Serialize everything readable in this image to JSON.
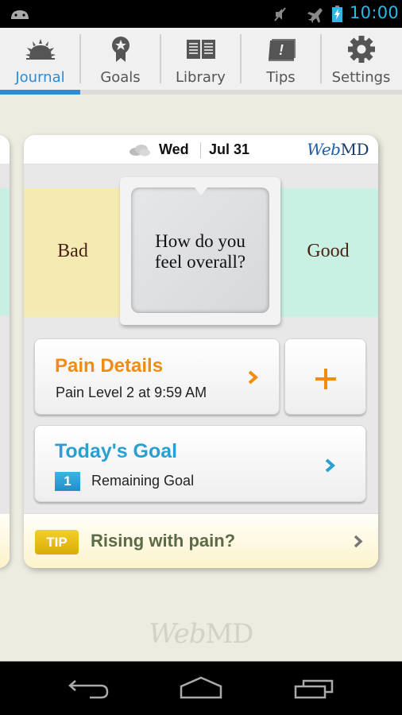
{
  "status_bar": {
    "time": "10:00",
    "icons": [
      "android-icon",
      "mute-icon",
      "airplane-mode-icon",
      "battery-charging-icon"
    ],
    "accent_color": "#33b5e5"
  },
  "tabs": [
    {
      "label": "Journal",
      "icon": "sunrise-icon",
      "active": true
    },
    {
      "label": "Goals",
      "icon": "award-ribbon-icon",
      "active": false
    },
    {
      "label": "Library",
      "icon": "open-book-icon",
      "active": false
    },
    {
      "label": "Tips",
      "icon": "tip-exclamation-icon",
      "active": false
    },
    {
      "label": "Settings",
      "icon": "gear-icon",
      "active": false
    }
  ],
  "card": {
    "weather_icon": "cloudy-icon",
    "day": "Wed",
    "date": "Jul 31",
    "brand": {
      "web": "Web",
      "md": "MD"
    },
    "mood": {
      "bad_label": "Bad",
      "good_label": "Good",
      "question_line1": "How do you",
      "question_line2": "feel overall?"
    },
    "pain": {
      "title": "Pain Details",
      "subtitle": "Pain Level 2 at 9:59 AM",
      "add_label": "+",
      "title_color": "#f08c10"
    },
    "goal": {
      "title": "Today's Goal",
      "count": "1",
      "subtitle": "Remaining Goal",
      "title_color": "#2a9fd1"
    },
    "tip": {
      "badge": "TIP",
      "text": "Rising with pain?"
    }
  },
  "footer": {
    "brand": {
      "web": "Web",
      "md": "MD"
    }
  },
  "nav": {
    "buttons": [
      "back-icon",
      "home-icon",
      "recent-apps-icon"
    ]
  }
}
